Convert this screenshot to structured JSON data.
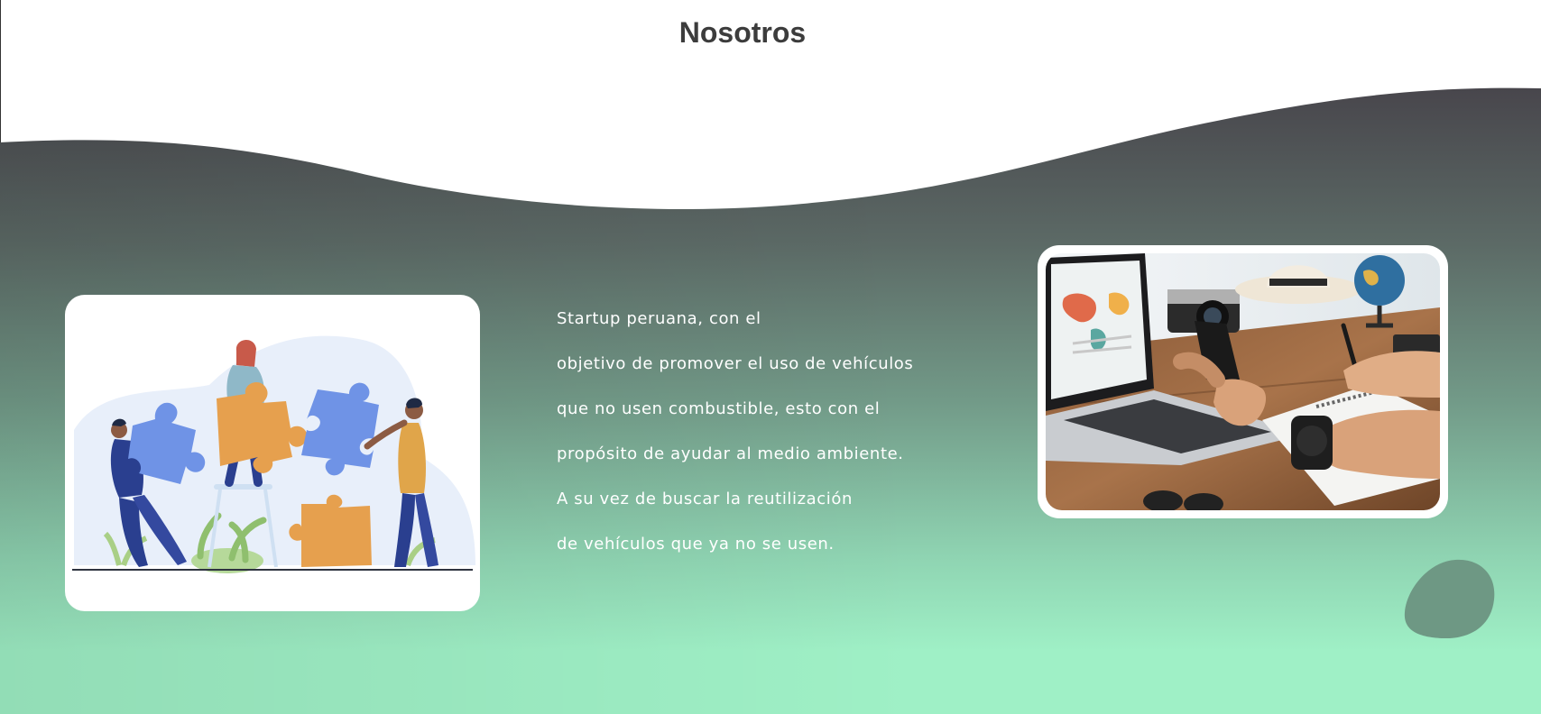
{
  "section": {
    "title": "Nosotros"
  },
  "about": {
    "lines": [
      "Startup peruana, con el",
      "objetivo de promover el uso de vehículos",
      "que no usen combustible, esto con el",
      "propósito de ayudar al medio ambiente.",
      "A su vez de buscar la reutilización",
      "de vehículos que ya no se usen."
    ]
  },
  "images": {
    "left": "teamwork-puzzle-illustration",
    "right": "laptop-desk-photo"
  },
  "colors": {
    "gradient_top": "#4b4a50",
    "gradient_mid": "#6f9585",
    "gradient_bottom": "#9eefc6",
    "blob": "#6f9985",
    "title": "#3c3c3c"
  }
}
